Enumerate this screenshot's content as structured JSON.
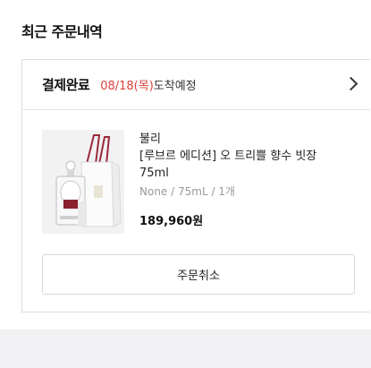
{
  "section": {
    "title": "최근 주문내역"
  },
  "order": {
    "status": "결제완료",
    "date": "08/18(목)",
    "delivery_text": "도착예정",
    "item": {
      "brand": "불리",
      "name_line1": "[루브르 에디션] 오 트리쁠 향수 빗장",
      "name_line2": "75ml",
      "option": "None / 75mL / 1개",
      "price": "189,960원"
    },
    "cancel_label": "주문취소"
  },
  "icons": {
    "chevron": "chevron-right-icon"
  },
  "colors": {
    "date_red": "#e0403a",
    "bottom_band": "#f1f1f3"
  }
}
